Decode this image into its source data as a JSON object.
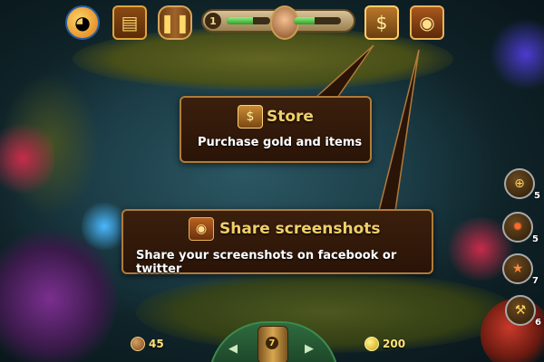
{
  "hud": {
    "level": "1",
    "energy_left": 0.6,
    "energy_right": 0.45,
    "icons": [
      "mascot-icon",
      "book-icon",
      "barrel-icon",
      "store-chest-icon",
      "camera-icon"
    ]
  },
  "tooltips": {
    "store": {
      "title": "Store",
      "description": "Purchase gold and items"
    },
    "share": {
      "title": "Share screenshots",
      "description": "Share your screenshots on facebook or twitter"
    }
  },
  "powerups": [
    {
      "name": "net",
      "count": "5"
    },
    {
      "name": "fire",
      "count": "5"
    },
    {
      "name": "starfish",
      "count": "7"
    },
    {
      "name": "hammer",
      "count": "6"
    }
  ],
  "bottom": {
    "pearls": "45",
    "coins": "200",
    "cannon_level": "7"
  },
  "colors": {
    "tooltip_bg": "#2a1407",
    "tooltip_border": "#b07b3a",
    "title": "#f0cf6a"
  }
}
